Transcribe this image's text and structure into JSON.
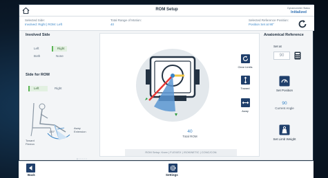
{
  "title": "ROM Setup",
  "dynamometer_status": {
    "label": "Dynamometer Status",
    "value": "Initialized"
  },
  "info": {
    "selected_side_label": "Selected Side:",
    "selected_side_value": "Involved: Right | ROM: Left",
    "total_range_label": "Total Range of Motion:",
    "total_range_value": "40",
    "reference_label": "Selected Reference Position:",
    "reference_value": "Position Set at 90°"
  },
  "left": {
    "involved_side_title": "Involved Side",
    "involved_options": [
      "Left",
      "Right",
      "Both",
      "None"
    ],
    "involved_selected": "Right",
    "side_rom_title": "Side for ROM",
    "rom_options": [
      "Left",
      "Right"
    ],
    "rom_selected": "Left",
    "toward_label": "Toward Flexion",
    "away_label": "Away Extension",
    "angle_label": "120°",
    "pager": "● ○ ○ ○ ○ ○"
  },
  "center": {
    "total_rom_value": "40",
    "total_rom_label": "Total ROM",
    "rom_setup_text": "ROM Setup: Knee | FLEX/EX | ISOKINETIC | CONC/CON",
    "clear_limits": "Clear Limits",
    "toward": "Toward",
    "away": "Away"
  },
  "right": {
    "anatomical_ref_title": "Anatomical Reference",
    "set_at_label": "Set at",
    "set_at_value": "90",
    "set_position": "Set Position",
    "current_angle_value": "90",
    "current_angle_label": "Current Angle",
    "set_limb_weight": "Set Limb Weight"
  },
  "bottom": {
    "back": "Back",
    "settings": "Settings"
  },
  "colors": {
    "accent": "#3a86c8",
    "navy": "#1f3f6b",
    "selected": "#5bb454",
    "limit": "#e53935"
  }
}
